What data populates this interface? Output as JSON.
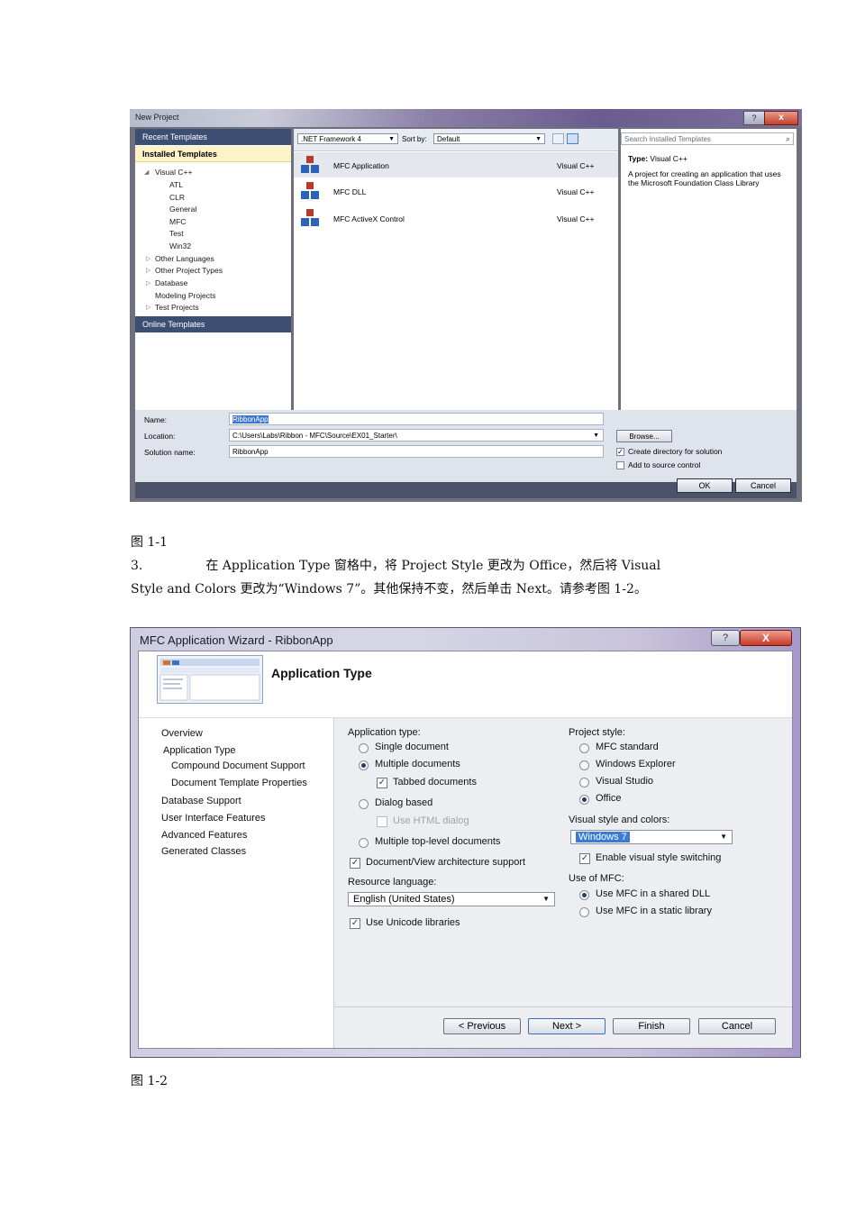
{
  "figure1": {
    "window_title": "New Project",
    "help_glyph": "?",
    "close_glyph": "x",
    "left_pane": {
      "recent_templates": "Recent Templates",
      "installed_templates": "Installed Templates",
      "tree": [
        "Visual C++",
        "ATL",
        "CLR",
        "General",
        "MFC",
        "Test",
        "Win32",
        "Other Languages",
        "Other Project Types",
        "Database",
        "Modeling Projects",
        "Test Projects"
      ],
      "online_templates": "Online Templates"
    },
    "toolbar": {
      "framework": ".NET Framework 4",
      "sort_by_label": "Sort by:",
      "sort_value": "Default"
    },
    "templates": [
      {
        "name": "MFC Application",
        "lang": "Visual C++"
      },
      {
        "name": "MFC DLL",
        "lang": "Visual C++"
      },
      {
        "name": "MFC ActiveX Control",
        "lang": "Visual C++"
      }
    ],
    "search_placeholder": "Search Installed Templates",
    "type_label": "Type:",
    "type_value": "Visual C++",
    "description": "A project for creating an application that uses the Microsoft Foundation Class Library",
    "fields": {
      "name_label": "Name:",
      "name_value": "RibbonApp",
      "location_label": "Location:",
      "location_value": "C:\\Users\\Labs\\Ribbon - MFC\\Source\\EX01_Starter\\",
      "solution_label": "Solution name:",
      "solution_value": "RibbonApp"
    },
    "browse_button": "Browse...",
    "create_dir": "Create directory for solution",
    "add_source": "Add to source control",
    "ok_button": "OK",
    "cancel_button": "Cancel"
  },
  "caption1": "图 1-1",
  "paragraph": {
    "line1": "3.　　　　　在 Application Type 窗格中，将 Project Style 更改为 Office，然后将 Visual",
    "line2": "Style and Colors 更改为“Windows 7”。其他保持不变，然后单击 Next。请参考图 1-2。"
  },
  "figure2": {
    "window_title": "MFC Application Wizard - RibbonApp",
    "help_glyph": "?",
    "close_glyph": "X",
    "heading": "Application Type",
    "nav": [
      "Overview",
      "Application Type",
      "Compound Document Support",
      "Document Template Properties",
      "Database Support",
      "User Interface Features",
      "Advanced Features",
      "Generated Classes"
    ],
    "app_type_label": "Application type:",
    "single_document": "Single document",
    "multiple_documents": "Multiple documents",
    "tabbed_documents": "Tabbed documents",
    "dialog_based": "Dialog based",
    "use_html_dialog": "Use HTML dialog",
    "multiple_top_level": "Multiple top-level documents",
    "doc_view": "Document/View architecture support",
    "resource_language_label": "Resource language:",
    "resource_language_value": "English (United States)",
    "use_unicode": "Use Unicode libraries",
    "project_style_label": "Project style:",
    "mfc_standard": "MFC standard",
    "windows_explorer": "Windows Explorer",
    "visual_studio": "Visual Studio",
    "office": "Office",
    "visual_style_label": "Visual style and colors:",
    "visual_style_value": "Windows 7",
    "enable_switching": "Enable visual style switching",
    "use_of_mfc_label": "Use of MFC:",
    "shared_dll": "Use MFC in a shared DLL",
    "static_lib": "Use MFC in a static library",
    "previous_button": "< Previous",
    "next_button": "Next >",
    "finish_button": "Finish",
    "cancel_button": "Cancel"
  },
  "caption2": "图 1-2"
}
